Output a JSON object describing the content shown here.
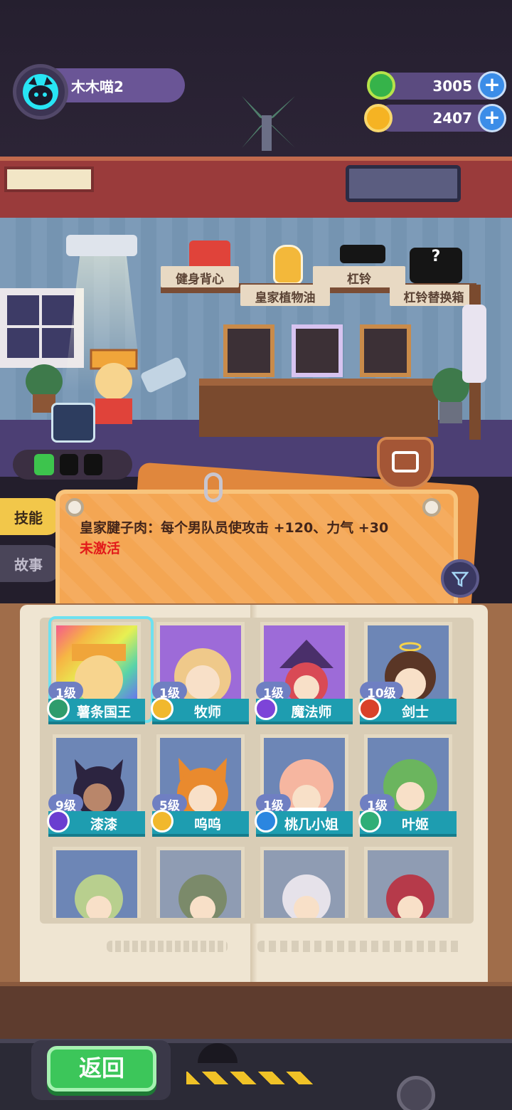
{
  "player": {
    "name": "木木喵2"
  },
  "currencies": [
    {
      "name": "donut-currency",
      "value": "3005",
      "color": "#36b34a"
    },
    {
      "name": "planet-currency",
      "value": "2407",
      "color": "#f5b323"
    }
  ],
  "shelf": {
    "items": [
      {
        "label": "健身背心"
      },
      {
        "label": "皇家植物油"
      },
      {
        "label": "杠铃"
      },
      {
        "label": "杠铃替换箱"
      }
    ]
  },
  "tabs": {
    "skill": "技能",
    "story": "故事"
  },
  "skill_panel": {
    "description": "皇家腱子肉：每个男队员使攻击 +120、力气 +30",
    "status": "未激活"
  },
  "heroes": [
    {
      "level": "1级",
      "name": "薯条国王",
      "role": "tank",
      "bg": "bg-rainbow"
    },
    {
      "level": "1级",
      "name": "牧师",
      "role": "support",
      "bg": "bg-purple"
    },
    {
      "level": "1级",
      "name": "魔法师",
      "role": "mage",
      "bg": "bg-purple"
    },
    {
      "level": "10级",
      "name": "剑士",
      "role": "warrior",
      "bg": "bg-blue"
    },
    {
      "level": "9级",
      "name": "漆漆",
      "role": "assassin",
      "bg": "bg-blue"
    },
    {
      "level": "5级",
      "name": "呜呜",
      "role": "support",
      "bg": "bg-blue"
    },
    {
      "level": "1级",
      "name": "桃几小姐",
      "role": "ranger",
      "bg": "bg-blue"
    },
    {
      "level": "1级",
      "name": "叶姬",
      "role": "heal",
      "bg": "bg-blue"
    }
  ],
  "buttons": {
    "back": "返回",
    "filter_icon": "filter-icon"
  }
}
